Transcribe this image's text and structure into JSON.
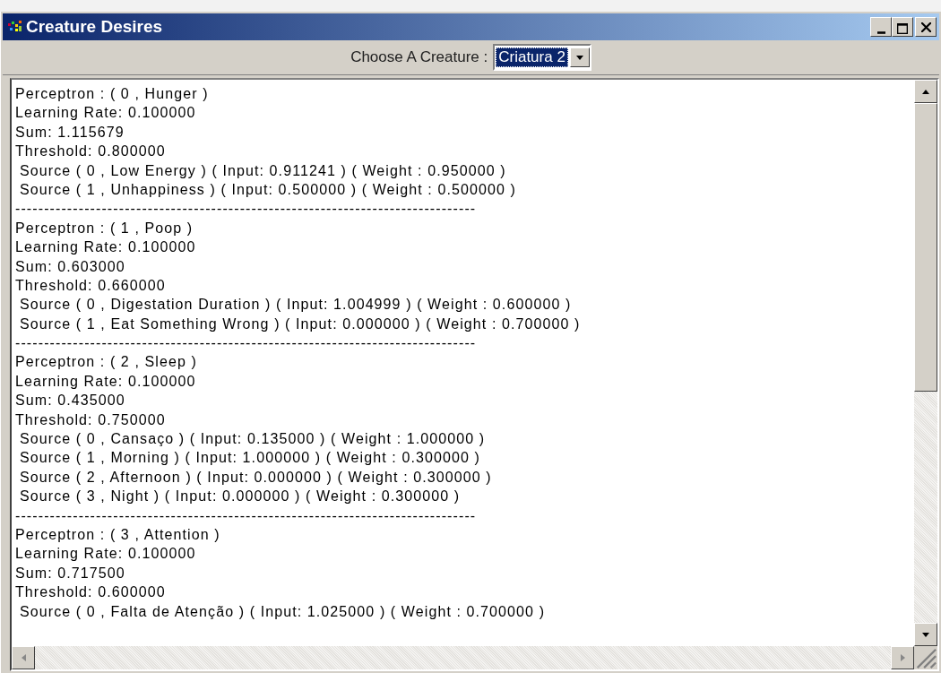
{
  "window": {
    "title": "Creature Desires"
  },
  "toolbar": {
    "label": "Choose A Creature :",
    "creature_select": {
      "value": "Criatura 2",
      "focused": true
    }
  },
  "perceptrons": [
    {
      "title": "Perceptron : ( 0 , Hunger )",
      "learning_rate": "Learning Rate: 0.100000",
      "sum": "Sum: 1.115679",
      "threshold": "Threshold: 0.800000",
      "sources": [
        "Source ( 0 , Low Energy ) ( Input: 0.911241 ) ( Weight : 0.950000 )",
        "Source ( 1 , Unhappiness ) ( Input: 0.500000 ) ( Weight : 0.500000 )"
      ],
      "separator": "--------------------------------------------------------------------------------"
    },
    {
      "title": "Perceptron : ( 1 , Poop )",
      "learning_rate": "Learning Rate: 0.100000",
      "sum": "Sum: 0.603000",
      "threshold": "Threshold: 0.660000",
      "sources": [
        "Source ( 0 , Digestation Duration ) ( Input: 1.004999 ) ( Weight : 0.600000 )",
        "Source ( 1 , Eat Something Wrong ) ( Input: 0.000000 ) ( Weight : 0.700000 )"
      ],
      "separator": "--------------------------------------------------------------------------------"
    },
    {
      "title": "Perceptron : ( 2 , Sleep )",
      "learning_rate": "Learning Rate: 0.100000",
      "sum": "Sum: 0.435000",
      "threshold": "Threshold: 0.750000",
      "sources": [
        "Source ( 0 , Cansaço ) ( Input: 0.135000 ) ( Weight : 1.000000 )",
        "Source ( 1 , Morning ) ( Input: 1.000000 ) ( Weight : 0.300000 )",
        "Source ( 2 , Afternoon ) ( Input: 0.000000 ) ( Weight : 0.300000 )",
        "Source ( 3 , Night ) ( Input: 0.000000 ) ( Weight : 0.300000 )"
      ],
      "separator": "--------------------------------------------------------------------------------"
    },
    {
      "title": "Perceptron : ( 3 , Attention )",
      "learning_rate": "Learning Rate: 0.100000",
      "sum": "Sum: 0.717500",
      "threshold": "Threshold: 0.600000",
      "sources": [
        "Source ( 0 , Falta de Atenção ) ( Input: 1.025000 ) ( Weight : 0.700000 )"
      ]
    }
  ]
}
